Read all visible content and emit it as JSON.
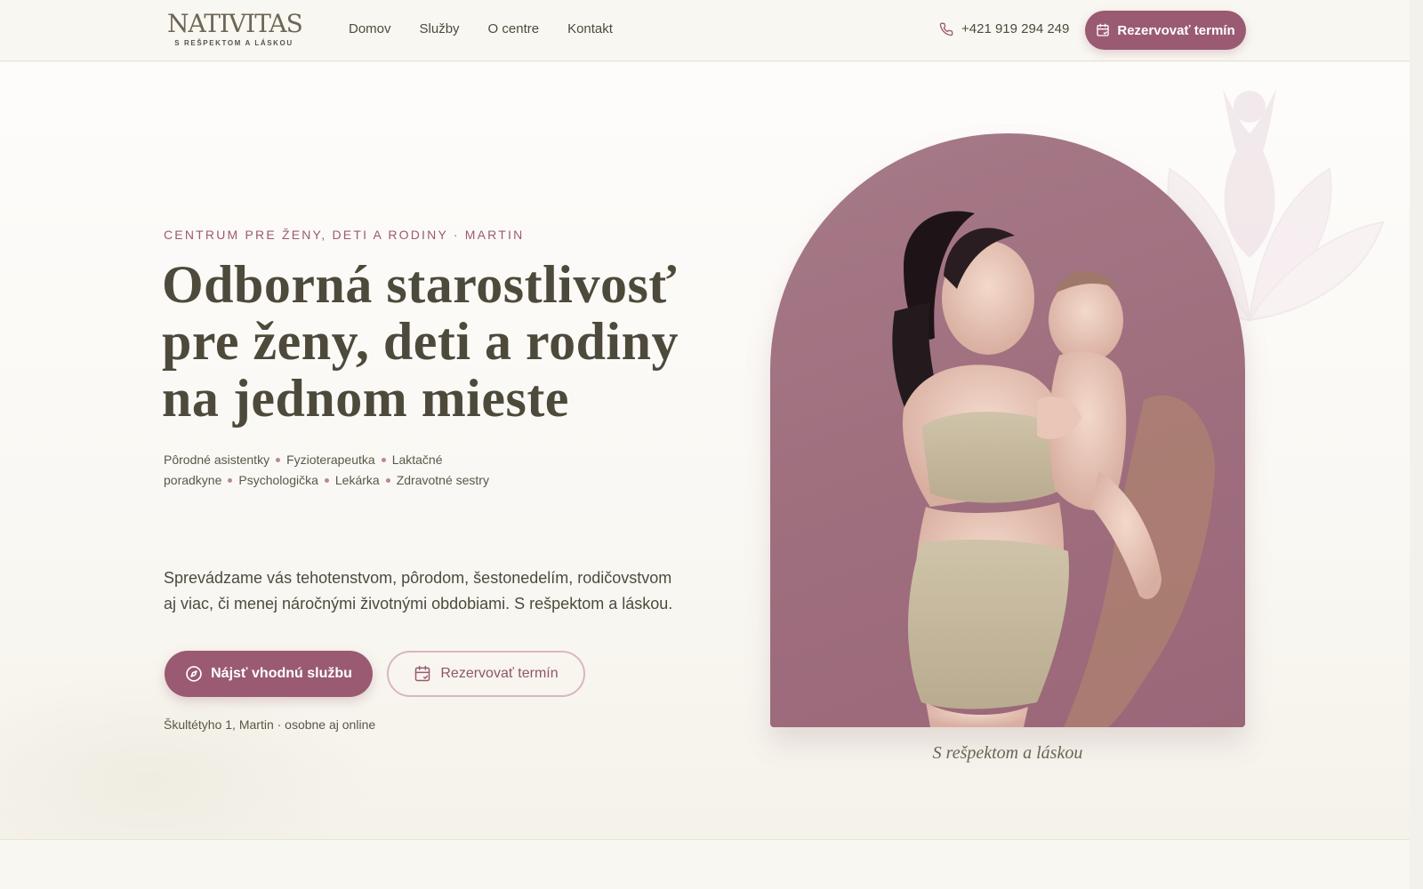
{
  "header": {
    "logo_word": "NATIVITAS",
    "logo_tagline": "S REŠPEKTOM A LÁSKOU",
    "nav": [
      "Domov",
      "Služby",
      "O centre",
      "Kontakt"
    ],
    "phone": "+421 919 294 249",
    "cta_label": "Rezervovať termín"
  },
  "hero": {
    "eyebrow": "CENTRUM PRE ŽENY, DETI A RODINY · MARTIN",
    "headline_lines": [
      "Odborná starostlivosť",
      "pre ženy, deti a rodiny",
      "na jednom mieste"
    ],
    "specialties": [
      "Pôrodné asistentky",
      "Fyzioterapeutka",
      "Laktačné poradkyne",
      "Psychologička",
      "Lekárka",
      "Zdravotné sestry"
    ],
    "lead": "Sprevádzame vás tehotenstvom, pôrodom, šestonedelím, rodičovstvom aj viac, či menej náročnými životnými obdobiami. S rešpektom a láskou.",
    "primary_button": "Nájsť vhodnú službu",
    "secondary_button": "Rezervovať termín",
    "address": "Škultétyho 1, Martin · osobne aj online",
    "image_caption": "S rešpektom a láskou"
  },
  "colors": {
    "accent": "#9a5a72",
    "background": "#f8f6f0",
    "text": "#4d4a3b",
    "arch_bg": "#a0707f"
  },
  "icons": [
    "phone-icon",
    "calendar-icon",
    "compass-icon",
    "lotus-goddess-icon"
  ]
}
